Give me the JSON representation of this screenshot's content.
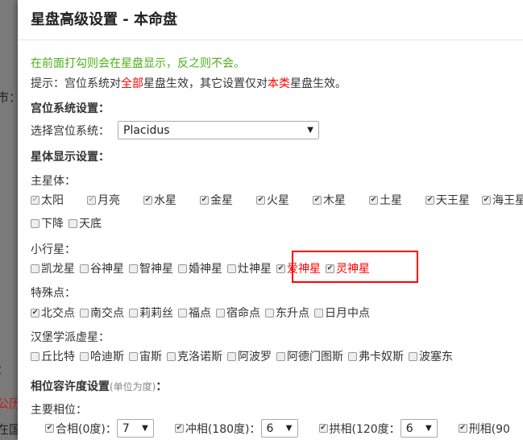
{
  "background": {
    "fragments": [
      "市：",
      "：",
      "公历",
      "在国"
    ]
  },
  "title": "星盘高级设置 - 本命盘",
  "hint_green": "在前面打勾则会在星盘显示，反之则不会。",
  "tip": {
    "a": "提示：宫位系统对",
    "b": "全部",
    "c": "星盘生效，其它设置仅对",
    "d": "本类",
    "e": "星盘生效。"
  },
  "house": {
    "heading": "宫位系统设置：",
    "label": "选择宫位系统：",
    "value": "Placidus"
  },
  "planet_heading": "星体显示设置：",
  "main": {
    "label": "主星体：",
    "items": [
      {
        "l": "太阳",
        "c": true,
        "d": true
      },
      {
        "l": "月亮",
        "c": true,
        "d": true
      },
      {
        "l": "水星",
        "c": true
      },
      {
        "l": "金星",
        "c": true
      },
      {
        "l": "火星",
        "c": true
      },
      {
        "l": "木星",
        "c": true
      },
      {
        "l": "土星",
        "c": true
      },
      {
        "l": "天王星",
        "c": true
      },
      {
        "l": "海王星",
        "c": true
      }
    ],
    "items2": [
      {
        "l": "下降",
        "c": false
      },
      {
        "l": "天底",
        "c": false
      }
    ]
  },
  "minor": {
    "label": "小行星：",
    "items": [
      {
        "l": "凯龙星",
        "c": false
      },
      {
        "l": "谷神星",
        "c": false
      },
      {
        "l": "智神星",
        "c": false
      },
      {
        "l": "婚神星",
        "c": false
      },
      {
        "l": "灶神星",
        "c": false
      },
      {
        "l": "爱神星",
        "c": true,
        "red": true
      },
      {
        "l": "灵神星",
        "c": true,
        "red": true
      }
    ]
  },
  "special": {
    "label": "特殊点：",
    "items": [
      {
        "l": "北交点",
        "c": true
      },
      {
        "l": "南交点",
        "c": false
      },
      {
        "l": "莉莉丝",
        "c": false
      },
      {
        "l": "福点",
        "c": false
      },
      {
        "l": "宿命点",
        "c": false
      },
      {
        "l": "东升点",
        "c": false
      },
      {
        "l": "日月中点",
        "c": false
      }
    ]
  },
  "hamburg": {
    "label": "汉堡学派虚星：",
    "items": [
      {
        "l": "丘比特",
        "c": false
      },
      {
        "l": "哈迪斯",
        "c": false
      },
      {
        "l": "宙斯",
        "c": false
      },
      {
        "l": "克洛诺斯",
        "c": false
      },
      {
        "l": "阿波罗",
        "c": false
      },
      {
        "l": "阿德门图斯",
        "c": false
      },
      {
        "l": "弗卡奴斯",
        "c": false
      },
      {
        "l": "波塞东",
        "c": false
      }
    ]
  },
  "aspect": {
    "heading": "相位容许度设置",
    "unit": "(单位为度)",
    "colon": "：",
    "major_label": "主要相位：",
    "items": [
      {
        "l": "合相(0度)：",
        "v": "7"
      },
      {
        "l": "冲相(180度)：",
        "v": "6"
      },
      {
        "l": "拱相(120度：",
        "v": "6"
      },
      {
        "l": "刑相(90",
        "v": ""
      }
    ]
  },
  "colors": {
    "green": "#4caf1a",
    "red": "#ff0000"
  }
}
